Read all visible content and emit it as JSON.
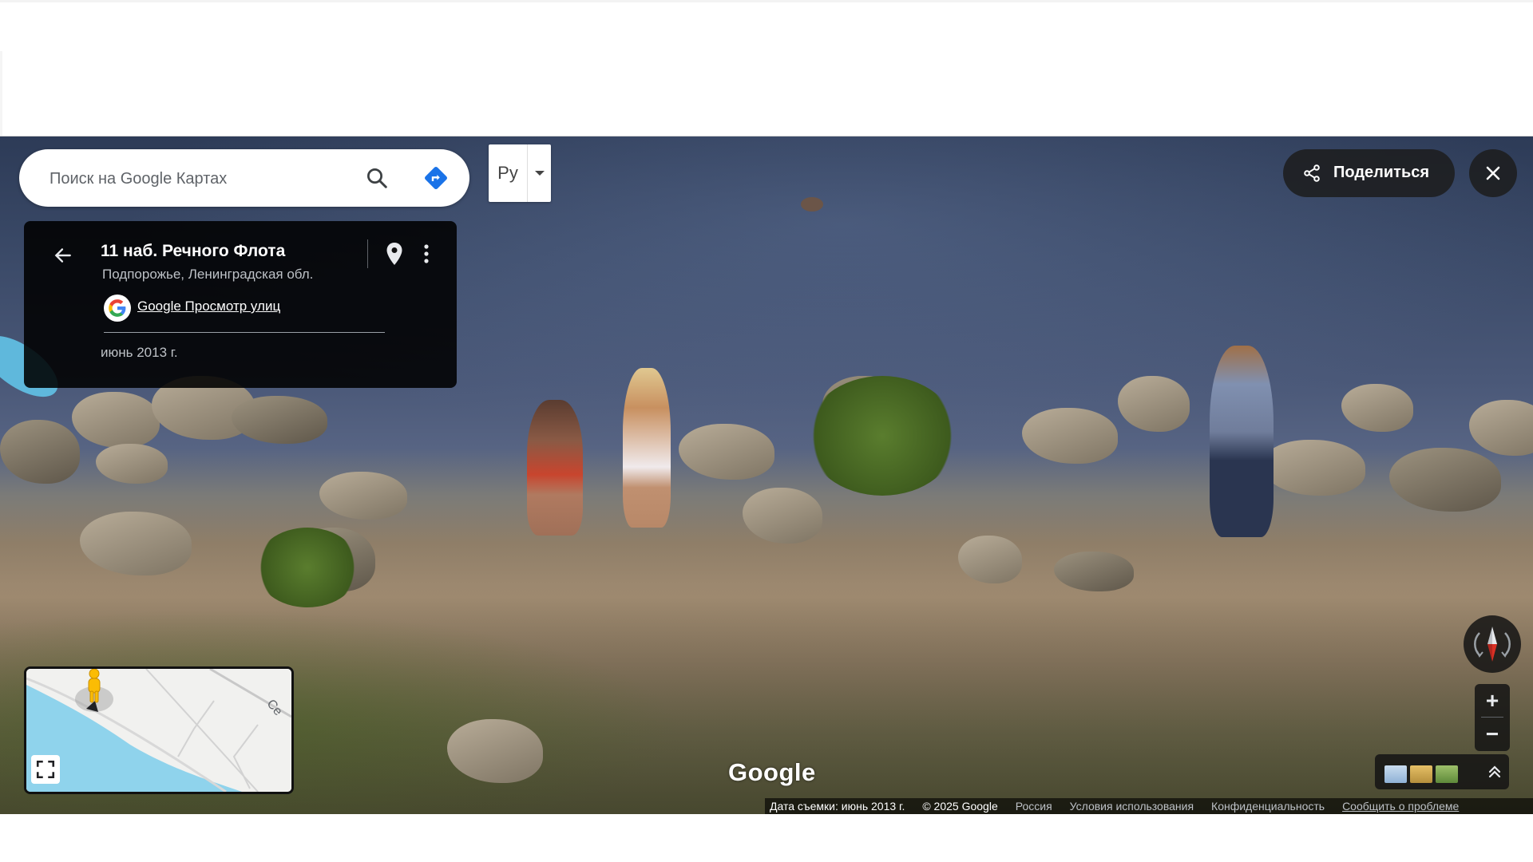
{
  "search": {
    "placeholder": "Поиск на Google Картах"
  },
  "language": {
    "code": "Ру"
  },
  "place": {
    "title": "11 наб. Речного Флота",
    "subtitle": "Подпорожье, Ленинградская обл.",
    "source_link": "Google Просмотр улиц",
    "capture_date": "июнь 2013 г."
  },
  "share": {
    "label": "Поделиться"
  },
  "zoom": {
    "in_label": "+",
    "out_label": "−"
  },
  "minimap": {
    "road_label": "Се"
  },
  "watermark": "Google",
  "footer": {
    "capture": "Дата съемки: июнь 2013 г.",
    "copyright": "© 2025 Google",
    "country": "Россия",
    "terms": "Условия использования",
    "privacy": "Конфиденциальность",
    "report": "Сообщить о проблеме"
  },
  "colors": {
    "accent_blue": "#1a73e8",
    "panel_dark": "#000000",
    "water": "#3b4a68",
    "sand": "#a08b71"
  },
  "icons": [
    "search-icon",
    "directions-icon",
    "chevron-down-icon",
    "arrow-back-icon",
    "pin-icon",
    "more-vert-icon",
    "google-g-icon",
    "share-icon",
    "close-icon",
    "compass-icon",
    "expand-up-icon",
    "fullscreen-icon",
    "pegman-icon"
  ]
}
